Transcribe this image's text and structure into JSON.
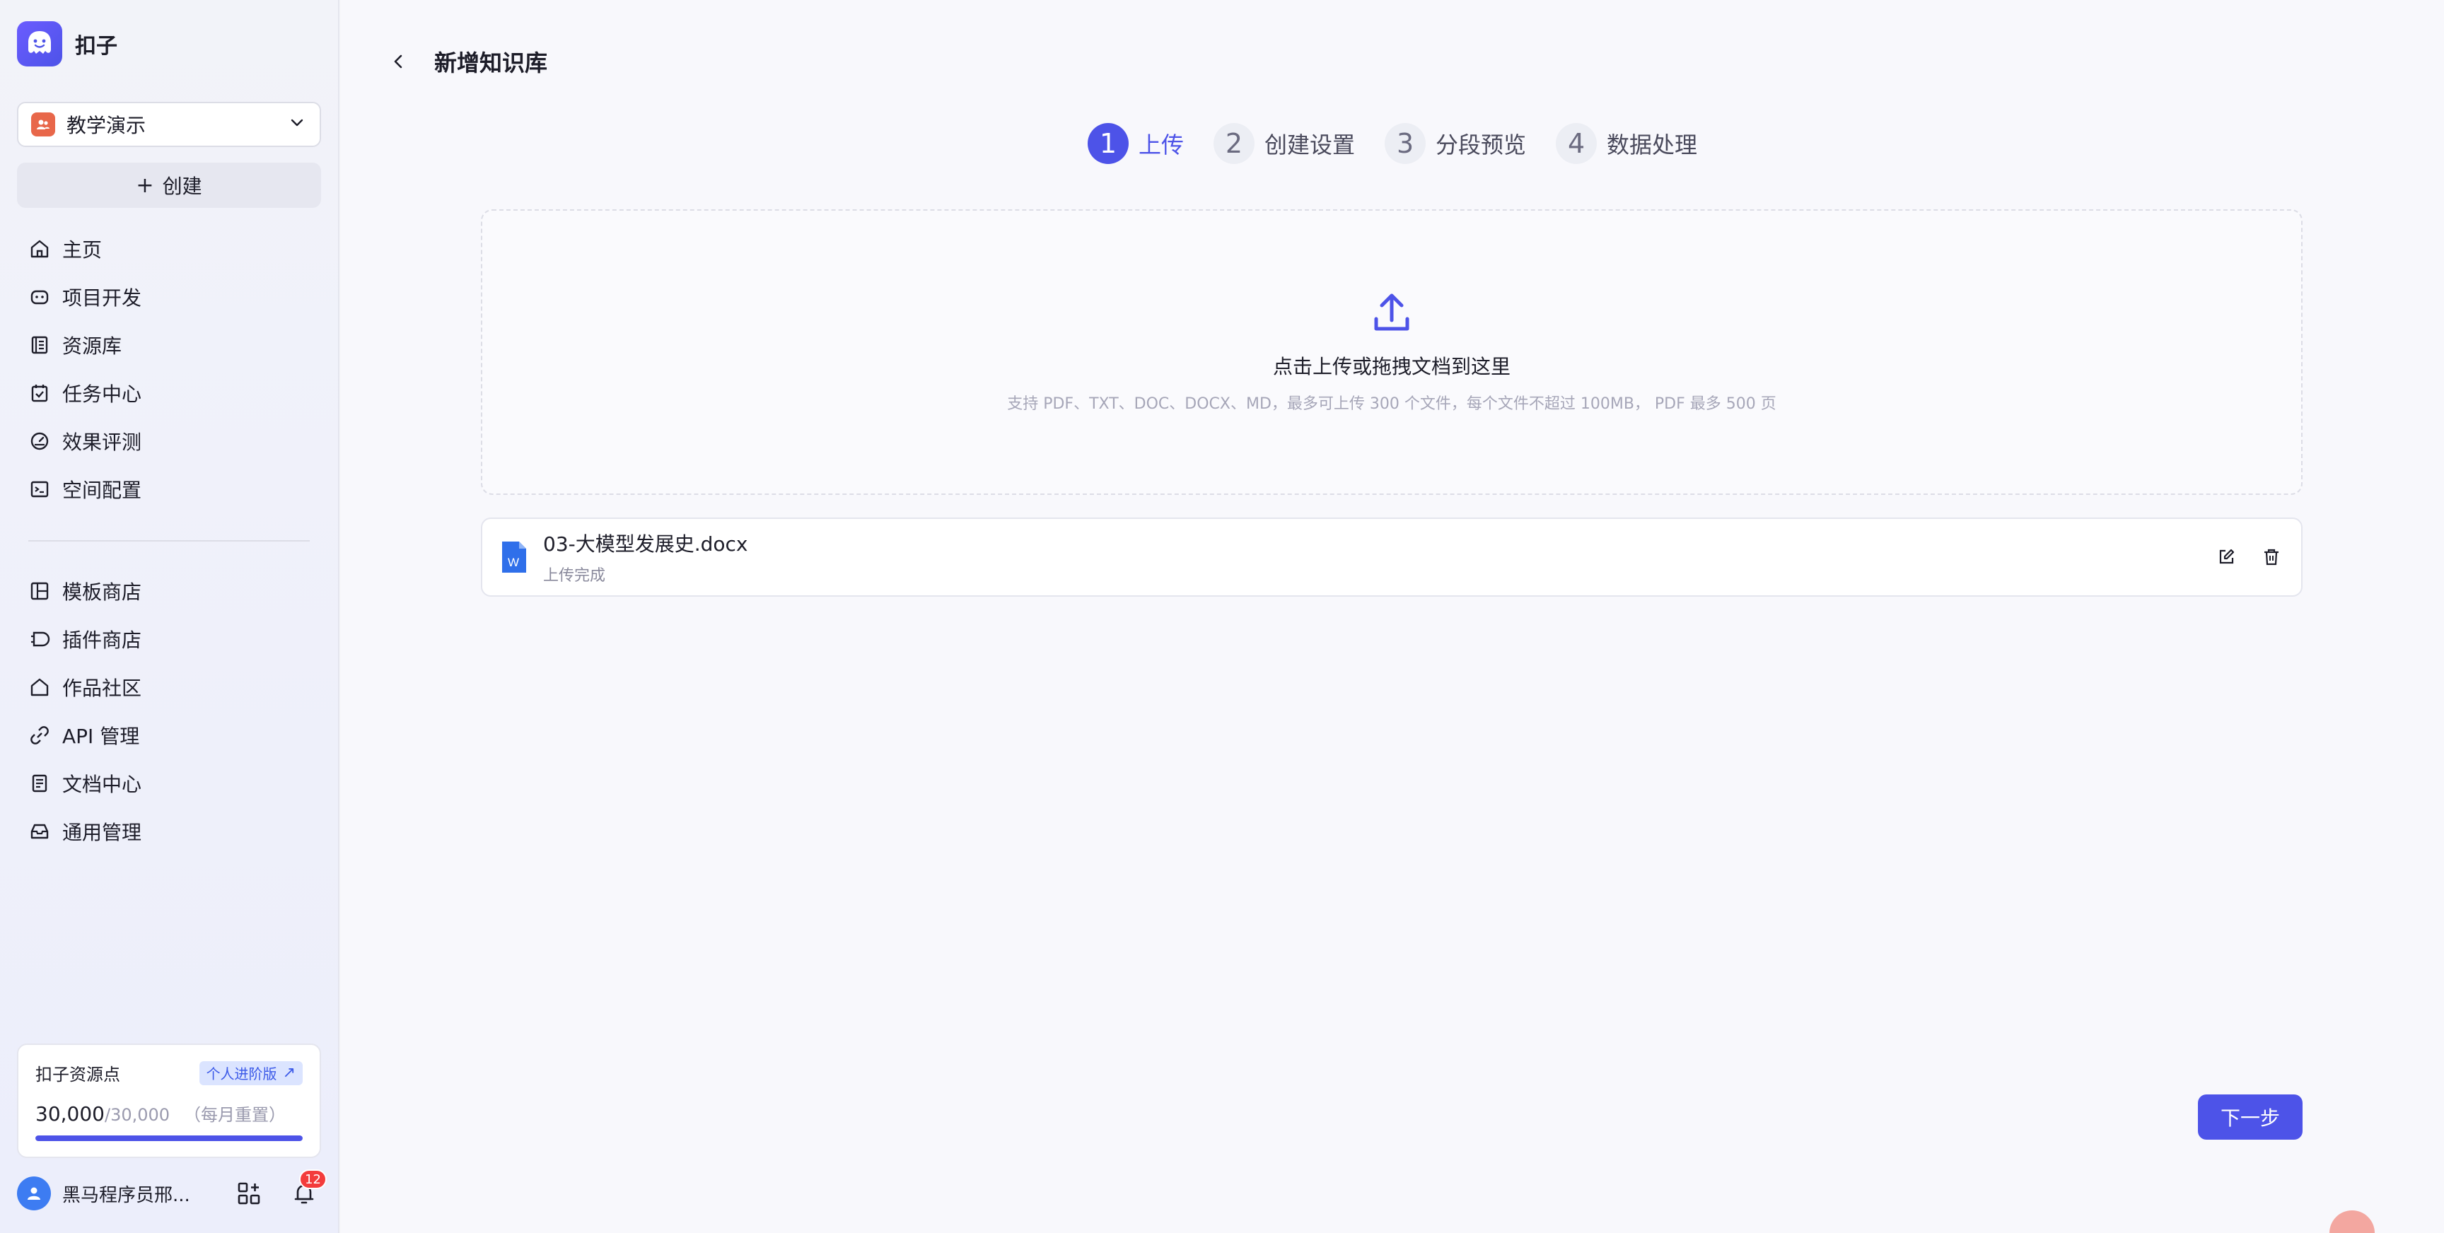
{
  "brand": {
    "name": "扣子"
  },
  "space": {
    "name": "教学演示"
  },
  "create_label": "创建",
  "nav_primary": [
    {
      "label": "主页",
      "icon": "home-icon"
    },
    {
      "label": "项目开发",
      "icon": "robot-icon"
    },
    {
      "label": "资源库",
      "icon": "library-icon"
    },
    {
      "label": "任务中心",
      "icon": "task-icon"
    },
    {
      "label": "效果评测",
      "icon": "gauge-icon"
    },
    {
      "label": "空间配置",
      "icon": "terminal-icon"
    }
  ],
  "nav_secondary": [
    {
      "label": "模板商店",
      "icon": "template-icon"
    },
    {
      "label": "插件商店",
      "icon": "plugin-icon"
    },
    {
      "label": "作品社区",
      "icon": "community-icon"
    },
    {
      "label": "API 管理",
      "icon": "api-icon"
    },
    {
      "label": "文档中心",
      "icon": "document-icon"
    },
    {
      "label": "通用管理",
      "icon": "inbox-icon"
    }
  ],
  "points": {
    "title": "扣子资源点",
    "tag": "个人进阶版",
    "value": "30,000",
    "max": "/30,000",
    "note": "（每月重置）",
    "fraction": 1.0
  },
  "user": {
    "name": "黑马程序员邢...",
    "badge": "12"
  },
  "page": {
    "title": "新增知识库"
  },
  "steps": [
    {
      "num": "1",
      "label": "上传",
      "active": true
    },
    {
      "num": "2",
      "label": "创建设置",
      "active": false
    },
    {
      "num": "3",
      "label": "分段预览",
      "active": false
    },
    {
      "num": "4",
      "label": "数据处理",
      "active": false
    }
  ],
  "upload": {
    "title": "点击上传或拖拽文档到这里",
    "hint": "支持 PDF、TXT、DOC、DOCX、MD，最多可上传 300 个文件，每个文件不超过 100MB， PDF 最多 500 页"
  },
  "file": {
    "name": "03-大模型发展史.docx",
    "status": "上传完成",
    "type_glyph": "W"
  },
  "next_label": "下一步",
  "colors": {
    "accent": "#4d53e8",
    "badge": "#f33c3c",
    "word": "#2f6fea"
  }
}
